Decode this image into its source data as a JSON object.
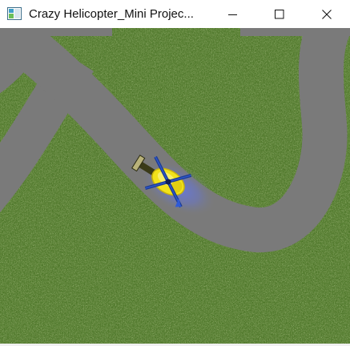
{
  "window": {
    "title": "Crazy Helicopter_Mini Projec...",
    "app_icon": "window-app-icon",
    "controls": {
      "minimize_icon": "minimize-icon",
      "maximize_icon": "maximize-icon",
      "close_icon": "close-icon"
    }
  },
  "game": {
    "scene": "grass-field-with-road",
    "player": "helicopter",
    "colors": {
      "grass": "#4f7a2a",
      "road": "#7b7b7b",
      "helicopter_body": "#f2e21a",
      "rotor": "#1f3f9a",
      "glow": "#5a6fd6"
    }
  }
}
